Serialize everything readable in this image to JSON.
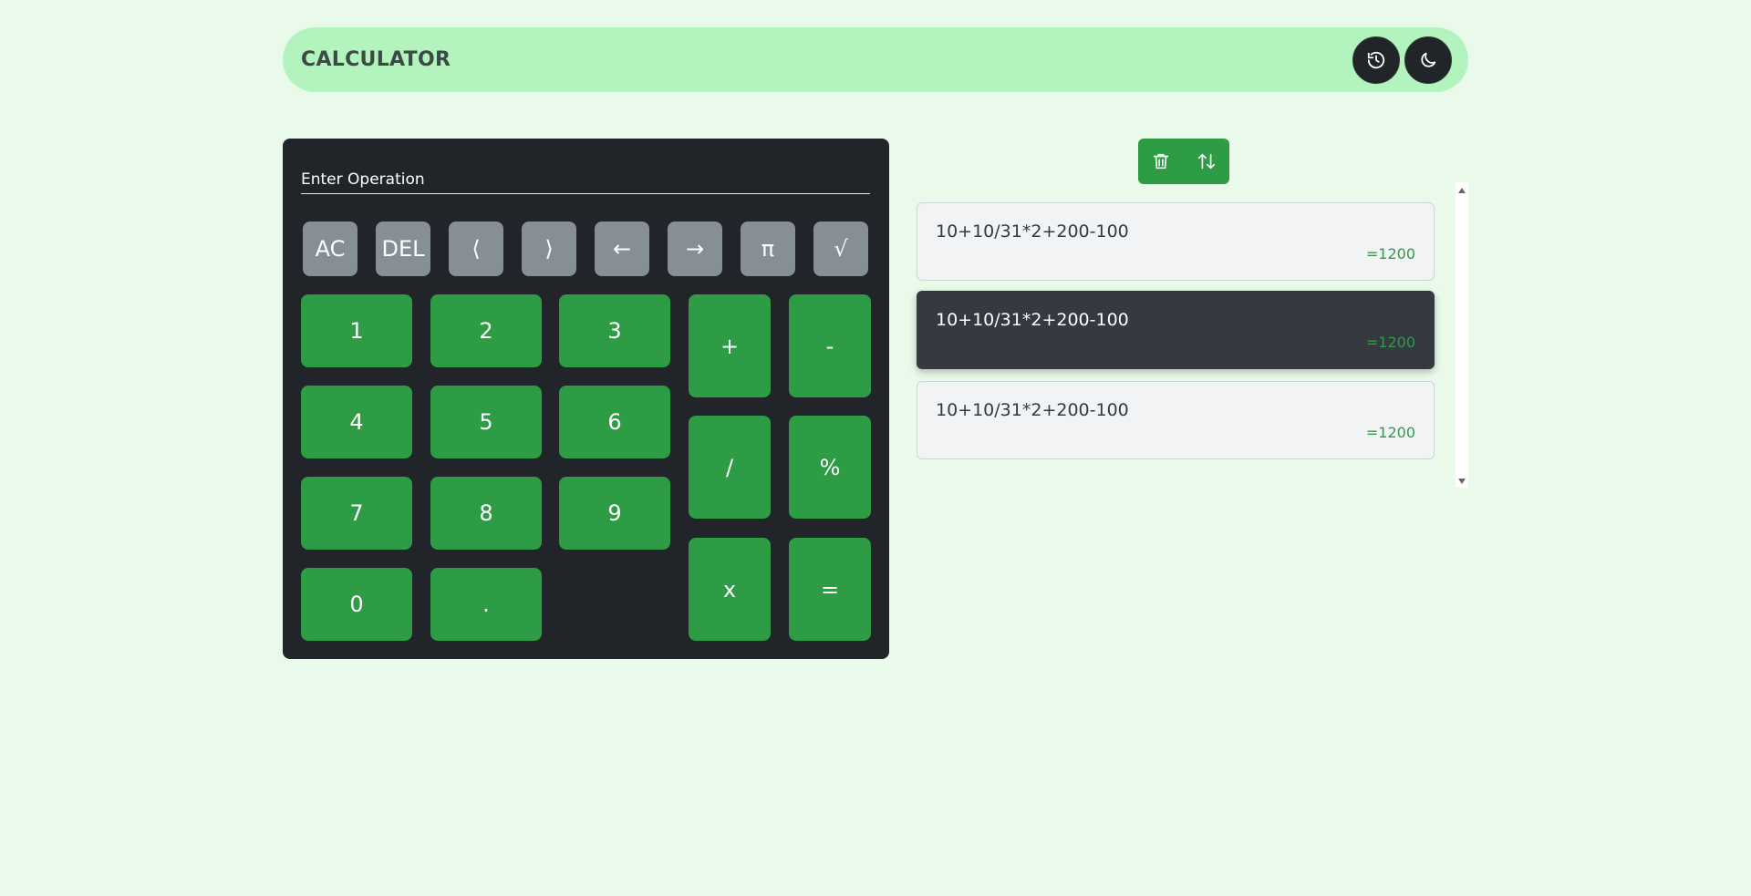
{
  "app": {
    "title": "CALCULATOR",
    "history_icon": "history-icon",
    "theme_icon": "moon-icon"
  },
  "calculator": {
    "placeholder": "Enter Operation",
    "function_keys": [
      "AC",
      "DEL",
      "⟨",
      "⟩",
      "←",
      "→",
      "π",
      "√"
    ],
    "number_keys": [
      "1",
      "2",
      "3",
      "4",
      "5",
      "6",
      "7",
      "8",
      "9",
      "0",
      "."
    ],
    "operator_keys": [
      "+",
      "-",
      "/",
      "%",
      "x",
      "="
    ]
  },
  "toolbar": {
    "clear_icon": "trash-icon",
    "sort_icon": "sort-arrows-icon"
  },
  "history": {
    "items": [
      {
        "expression": "10+10/31*2+200-100",
        "result": "=1200",
        "active": false
      },
      {
        "expression": "10+10/31*2+200-100",
        "result": "=1200",
        "active": true
      },
      {
        "expression": "10+10/31*2+200-100",
        "result": "=1200",
        "active": false
      }
    ]
  },
  "colors": {
    "page_bg": "#e9f9ea",
    "navbar_bg": "#b3f3bd",
    "panel_bg": "#212529",
    "accent_green": "#2e9b45",
    "function_key_gray": "#868e96"
  }
}
